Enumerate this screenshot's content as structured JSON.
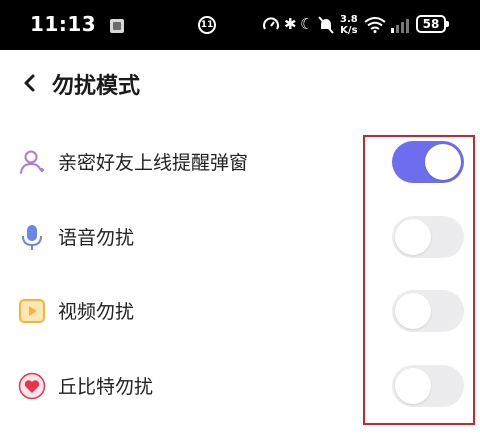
{
  "status_bar": {
    "time": "11:13",
    "notification_badge": "11",
    "net_speed_value": "3.8",
    "net_speed_unit": "K/s",
    "battery": "58"
  },
  "header": {
    "title": "勿扰模式",
    "back_icon": "chevron-left-icon"
  },
  "settings": [
    {
      "label": "亲密好友上线提醒弹窗",
      "icon": "person-icon",
      "icon_color": "#b07ad8",
      "enabled": true
    },
    {
      "label": "语音勿扰",
      "icon": "microphone-icon",
      "icon_color": "#6a86e6",
      "enabled": false
    },
    {
      "label": "视频勿扰",
      "icon": "video-icon",
      "icon_color": "#f7b531",
      "enabled": false
    },
    {
      "label": "丘比特勿扰",
      "icon": "heart-icon",
      "icon_color": "#e8344e",
      "enabled": false
    }
  ],
  "colors": {
    "toggle_on": "#6d6dee",
    "toggle_off": "#ecebee",
    "highlight_box": "#d4202a"
  }
}
